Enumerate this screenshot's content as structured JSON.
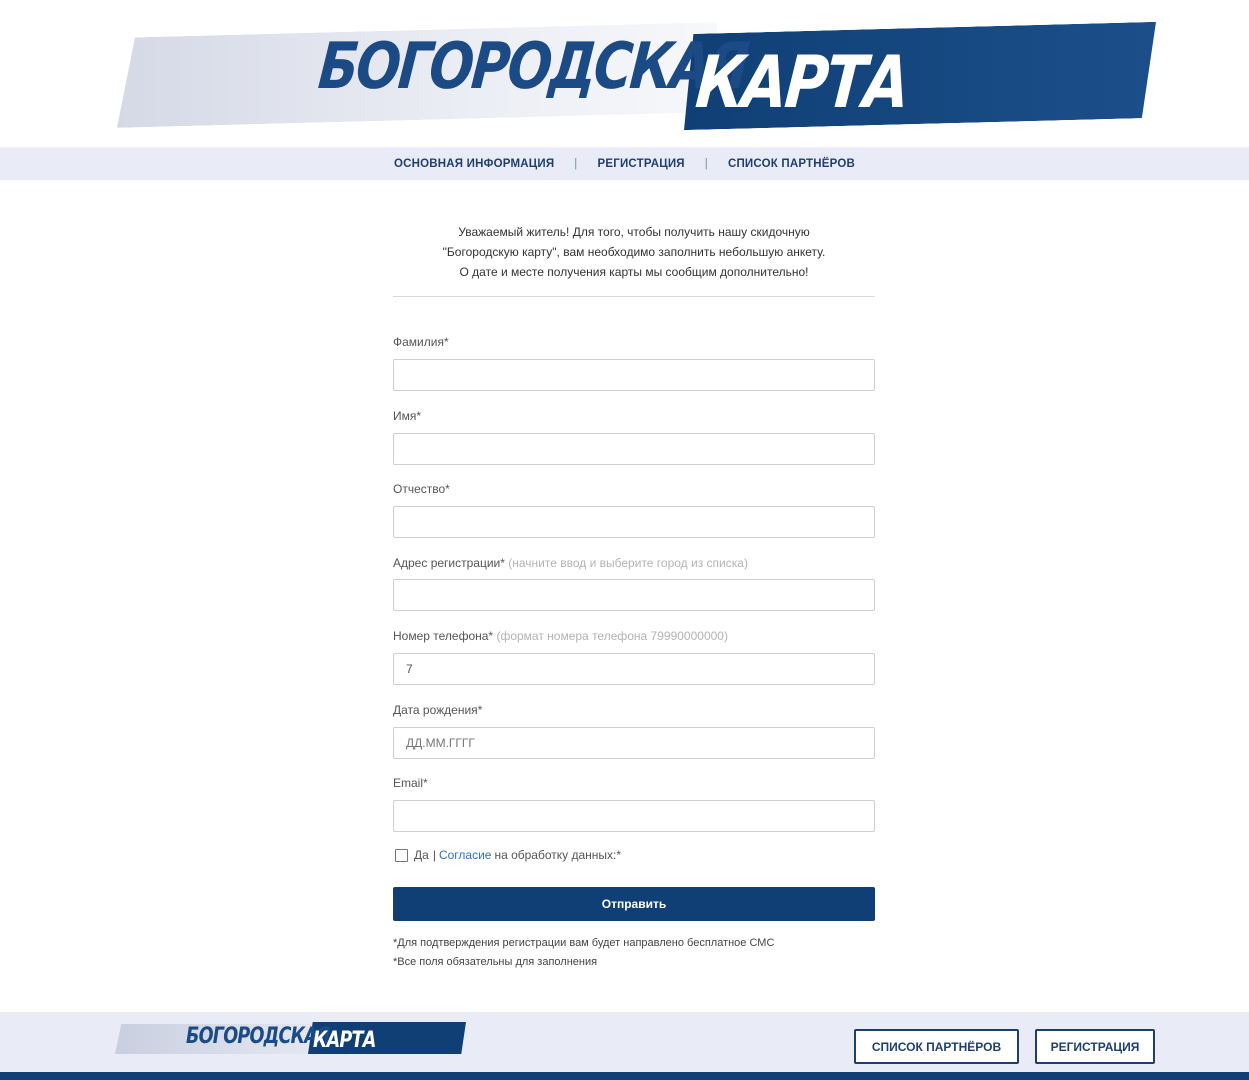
{
  "logo": {
    "word1": "БОГОРОДСКАЯ",
    "word2": "КАРТА"
  },
  "nav": {
    "items": [
      "ОСНОВНАЯ ИНФОРМАЦИЯ",
      "РЕГИСТРАЦИЯ",
      "СПИСОК ПАРТНЁРОВ"
    ],
    "separator": "|"
  },
  "intro": {
    "line1": "Уважаемый житель! Для того, чтобы получить нашу скидочную",
    "line2": "\"Богородскую карту\", вам необходимо заполнить небольшую анкету.",
    "line3": "О дате и месте получения карты мы сообщим дополнительно!"
  },
  "form": {
    "surname": {
      "label": "Фамилия*",
      "value": ""
    },
    "name": {
      "label": "Имя*",
      "value": ""
    },
    "patronymic": {
      "label": "Отчество*",
      "value": ""
    },
    "address": {
      "label": "Адрес регистрации*",
      "hint": "(начните ввод и выберите город из списка)",
      "value": ""
    },
    "phone": {
      "label": "Номер телефона*",
      "hint": "(формат номера телефона 79990000000)",
      "value": "7"
    },
    "birthdate": {
      "label": "Дата рождения*",
      "placeholder": "ДД.ММ.ГГГГ"
    },
    "email": {
      "label": "Email*",
      "value": ""
    },
    "consent": {
      "yes": "Да",
      "pipe": "|",
      "link": "Согласие",
      "rest": "на обработку данных:*",
      "checked": false
    },
    "submit": "Отправить",
    "notes": [
      "*Для подтверждения регистрации вам будет направлено бесплатное СМС",
      "*Все поля обязательны для заполнения"
    ]
  },
  "footer": {
    "buttons": [
      "СПИСОК ПАРТНЁРОВ",
      "РЕГИСТРАЦИЯ"
    ]
  },
  "colors": {
    "brand_dark": "#0f3f75",
    "nav_bg": "#e9ecf6",
    "link": "#2f6fd1"
  }
}
